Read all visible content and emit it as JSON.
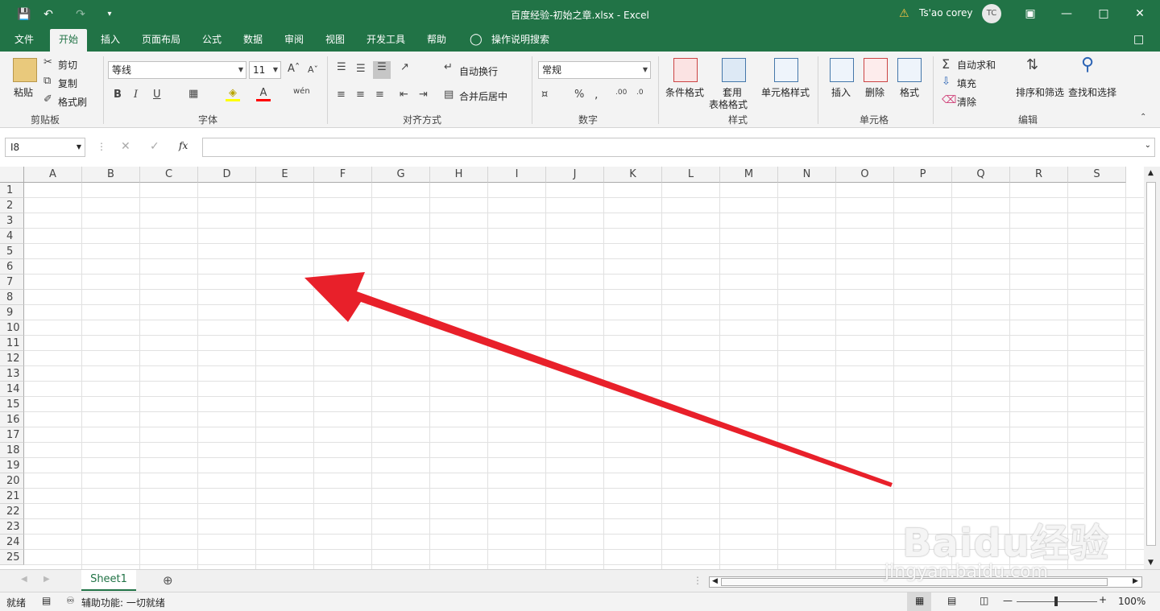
{
  "window": {
    "title": "百度经验-初始之章.xlsx  -  Excel",
    "user_name": "Ts'ao corey",
    "user_initials": "TC",
    "warning_icon": "⚠"
  },
  "tabs": [
    {
      "label": "文件"
    },
    {
      "label": "开始"
    },
    {
      "label": "插入"
    },
    {
      "label": "页面布局"
    },
    {
      "label": "公式"
    },
    {
      "label": "数据"
    },
    {
      "label": "审阅"
    },
    {
      "label": "视图"
    },
    {
      "label": "开发工具"
    },
    {
      "label": "帮助"
    },
    {
      "label": "操作说明搜索"
    }
  ],
  "ribbon": {
    "clipboard": {
      "paste": "粘贴",
      "cut": "剪切",
      "copy": "复制",
      "format_painter": "格式刷",
      "group": "剪贴板"
    },
    "font": {
      "name": "等线",
      "size": "11",
      "group": "字体"
    },
    "alignment": {
      "wrap": "自动换行",
      "merge": "合并后居中",
      "group": "对齐方式"
    },
    "number": {
      "format": "常规",
      "group": "数字"
    },
    "styles": {
      "conditional": "条件格式",
      "table_1": "套用",
      "table_2": "表格格式",
      "cell_styles": "单元格样式",
      "group": "样式"
    },
    "cells": {
      "insert": "插入",
      "delete": "删除",
      "format": "格式",
      "group": "单元格"
    },
    "editing": {
      "autosum": "自动求和",
      "fill": "填充",
      "clear": "清除",
      "sort": "排序和筛选",
      "find": "查找和选择",
      "group": "编辑"
    }
  },
  "formula_bar": {
    "name_box": "I8",
    "fx": "fx",
    "content": ""
  },
  "columns": [
    "A",
    "B",
    "C",
    "D",
    "E",
    "F",
    "G",
    "H",
    "I",
    "J",
    "K",
    "L",
    "M",
    "N",
    "O",
    "P",
    "Q",
    "R",
    "S"
  ],
  "rows": [
    "1",
    "2",
    "3",
    "4",
    "5",
    "6",
    "7",
    "8",
    "9",
    "10",
    "11",
    "12",
    "13",
    "14",
    "15",
    "16",
    "17",
    "18",
    "19",
    "20",
    "21",
    "22",
    "23",
    "24",
    "25"
  ],
  "sheets": [
    {
      "label": "Sheet1"
    }
  ],
  "status": {
    "ready": "就绪",
    "accessibility": "辅助功能: 一切就绪",
    "zoom": "100%"
  },
  "watermark": {
    "brand": "Baidu经验",
    "url": "jingyan.baidu.com"
  },
  "colors": {
    "accent": "#217346",
    "arrow": "#e8202a"
  }
}
